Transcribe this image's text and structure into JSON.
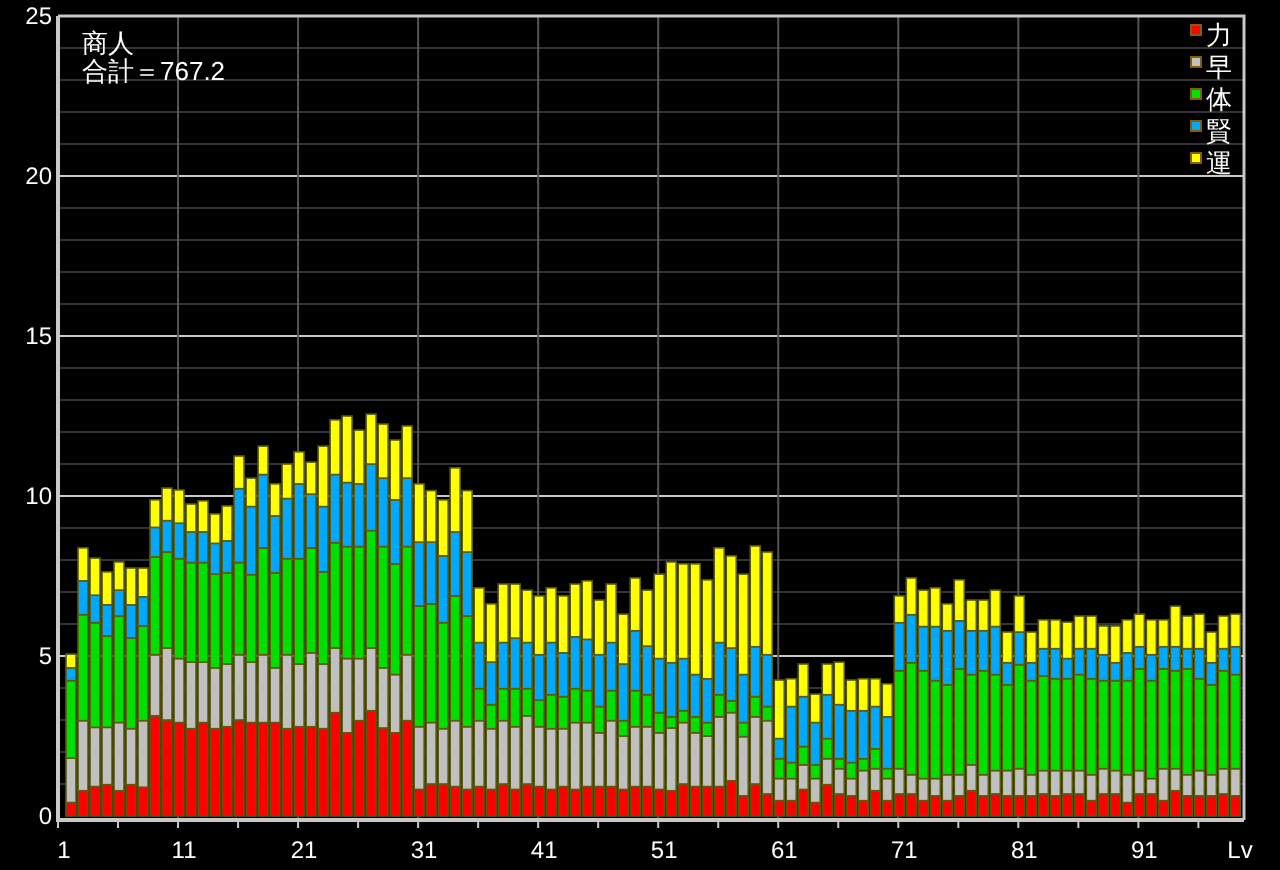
{
  "chart_data": {
    "type": "bar",
    "stacked": true,
    "grid": true,
    "legend": "upper right",
    "orientation": "vertical",
    "title": "商人",
    "annotations": [
      "合計＝767.2"
    ],
    "xlabel": "Lv",
    "xlim": [
      1,
      99.8
    ],
    "ylim": [
      0,
      25
    ],
    "xticks": [
      1,
      11,
      21,
      31,
      41,
      51,
      61,
      71,
      81,
      91
    ],
    "yticks": [
      0,
      5,
      10,
      15,
      20,
      25
    ],
    "x": [
      2,
      3,
      4,
      5,
      6,
      7,
      8,
      9,
      10,
      11,
      12,
      13,
      14,
      15,
      16,
      17,
      18,
      19,
      20,
      21,
      22,
      23,
      24,
      25,
      26,
      27,
      28,
      29,
      30,
      31,
      32,
      33,
      34,
      35,
      36,
      37,
      38,
      39,
      40,
      41,
      42,
      43,
      44,
      45,
      46,
      47,
      48,
      49,
      50,
      51,
      52,
      53,
      54,
      55,
      56,
      57,
      58,
      59,
      60,
      61,
      62,
      63,
      64,
      65,
      66,
      67,
      68,
      69,
      70,
      71,
      72,
      73,
      74,
      75,
      76,
      77,
      78,
      79,
      80,
      81,
      82,
      83,
      84,
      85,
      86,
      87,
      88,
      89,
      90,
      91,
      92,
      93,
      94,
      95,
      96,
      97,
      98,
      99
    ],
    "series": [
      {
        "name": "力",
        "color": "#ff0000",
        "values": [
          0.42,
          0.79,
          0.92,
          0.98,
          0.79,
          0.98,
          0.9,
          3.13,
          3.0,
          2.92,
          2.73,
          2.92,
          2.73,
          2.79,
          3.0,
          2.92,
          2.92,
          2.92,
          2.73,
          2.79,
          2.79,
          2.73,
          3.23,
          2.6,
          2.98,
          3.29,
          2.75,
          2.6,
          2.98,
          0.83,
          1.0,
          1.0,
          0.92,
          0.83,
          0.92,
          0.83,
          1.0,
          0.83,
          1.0,
          0.92,
          0.83,
          0.92,
          0.83,
          0.92,
          0.92,
          0.92,
          0.83,
          0.92,
          0.92,
          0.83,
          0.79,
          1.0,
          0.92,
          0.92,
          0.92,
          1.1,
          0.63,
          1.0,
          0.69,
          0.48,
          0.48,
          0.83,
          0.42,
          0.98,
          0.69,
          0.63,
          0.48,
          0.79,
          0.48,
          0.69,
          0.69,
          0.48,
          0.63,
          0.48,
          0.63,
          0.79,
          0.63,
          0.69,
          0.63,
          0.63,
          0.63,
          0.69,
          0.63,
          0.69,
          0.69,
          0.48,
          0.69,
          0.69,
          0.42,
          0.69,
          0.69,
          0.48,
          0.79,
          0.63,
          0.63,
          0.63,
          0.69,
          0.63
        ]
      },
      {
        "name": "早",
        "color": "#c0c0c0",
        "values": [
          1.39,
          2.19,
          1.85,
          1.79,
          2.13,
          1.75,
          2.08,
          1.91,
          2.25,
          2.0,
          2.08,
          1.89,
          1.9,
          1.96,
          2.04,
          1.89,
          2.12,
          1.71,
          2.31,
          1.96,
          2.31,
          2.02,
          2.02,
          2.32,
          1.94,
          1.96,
          1.88,
          1.82,
          2.06,
          1.96,
          1.92,
          1.73,
          2.06,
          1.96,
          2.06,
          1.9,
          1.98,
          1.96,
          2.13,
          1.87,
          1.9,
          1.81,
          2.09,
          2.0,
          1.68,
          2.06,
          1.67,
          1.87,
          1.87,
          1.77,
          1.96,
          1.92,
          1.68,
          1.58,
          2.18,
          2.13,
          1.85,
          2.1,
          2.29,
          0.69,
          0.69,
          0.77,
          0.75,
          0.81,
          0.79,
          0.54,
          0.94,
          0.69,
          0.69,
          0.79,
          0.6,
          0.69,
          0.54,
          0.81,
          0.66,
          0.81,
          0.66,
          0.73,
          0.79,
          0.85,
          0.66,
          0.73,
          0.79,
          0.73,
          0.73,
          0.81,
          0.79,
          0.73,
          0.87,
          0.73,
          0.48,
          1.0,
          0.69,
          0.66,
          0.79,
          0.66,
          0.79,
          0.85
        ]
      },
      {
        "name": "体",
        "color": "#00e000",
        "values": [
          2.42,
          3.31,
          3.27,
          2.86,
          3.33,
          2.83,
          2.96,
          3.06,
          3.0,
          3.12,
          3.11,
          3.11,
          2.93,
          2.85,
          2.88,
          2.73,
          3.34,
          2.97,
          3.0,
          3.29,
          3.28,
          2.88,
          3.29,
          3.5,
          3.5,
          3.67,
          3.79,
          3.46,
          3.38,
          3.77,
          3.71,
          3.31,
          3.9,
          3.46,
          1.0,
          0.75,
          1.0,
          1.19,
          0.85,
          0.84,
          1.06,
          1.0,
          1.06,
          1.0,
          0.82,
          0.94,
          0.48,
          1.13,
          1.0,
          0.63,
          0.35,
          0.37,
          0.5,
          0.42,
          0.69,
          0.37,
          0.44,
          0.63,
          0.44,
          0.62,
          0.5,
          0.57,
          0.43,
          0.63,
          0.31,
          0.5,
          0.37,
          0.62,
          0.31,
          3.06,
          3.5,
          3.37,
          3.06,
          2.81,
          3.31,
          2.82,
          3.25,
          3.0,
          2.68,
          3.25,
          2.94,
          2.96,
          2.87,
          2.87,
          3.0,
          3.0,
          2.75,
          2.81,
          2.94,
          3.18,
          3.06,
          3.12,
          3.06,
          3.31,
          2.87,
          2.81,
          3.06,
          2.94
        ]
      },
      {
        "name": "賢",
        "color": "#00a8ff",
        "values": [
          0.4,
          1.06,
          0.86,
          0.97,
          0.81,
          1.04,
          0.91,
          0.92,
          0.98,
          1.11,
          0.96,
          0.96,
          0.96,
          1.0,
          2.31,
          2.13,
          2.29,
          1.78,
          1.88,
          2.34,
          1.68,
          2.04,
          2.13,
          2.0,
          1.96,
          2.08,
          2.14,
          2.0,
          2.14,
          2.0,
          1.93,
          2.09,
          2.0,
          2.0,
          1.44,
          1.33,
          1.44,
          1.58,
          1.44,
          1.41,
          1.63,
          1.37,
          1.62,
          1.6,
          1.62,
          1.5,
          1.77,
          1.87,
          1.52,
          1.69,
          1.69,
          1.63,
          1.32,
          1.37,
          1.63,
          1.65,
          1.5,
          1.56,
          1.62,
          0.63,
          1.75,
          1.56,
          1.32,
          1.37,
          1.69,
          1.62,
          1.5,
          1.32,
          1.62,
          1.5,
          1.5,
          1.38,
          1.69,
          1.69,
          1.5,
          1.37,
          1.25,
          1.5,
          0.69,
          1.02,
          0.56,
          0.85,
          0.94,
          0.63,
          0.81,
          0.94,
          0.81,
          0.56,
          0.87,
          0.69,
          0.81,
          0.69,
          0.75,
          0.63,
          0.94,
          0.69,
          0.69,
          0.87
        ]
      },
      {
        "name": "運",
        "color": "#ffff00",
        "values": [
          0.43,
          1.03,
          1.16,
          1.03,
          0.88,
          1.15,
          0.9,
          0.86,
          1.02,
          1.04,
          0.87,
          0.97,
          0.92,
          1.09,
          1.02,
          0.89,
          0.89,
          1.0,
          1.08,
          1.0,
          1.0,
          1.89,
          1.71,
          2.08,
          1.68,
          1.56,
          1.69,
          1.87,
          1.63,
          1.82,
          1.61,
          1.75,
          2.0,
          1.92,
          1.71,
          1.82,
          1.83,
          1.69,
          1.64,
          1.84,
          1.71,
          1.78,
          1.65,
          1.83,
          1.71,
          1.83,
          1.56,
          1.65,
          1.75,
          2.64,
          3.15,
          2.96,
          3.46,
          3.09,
          2.96,
          2.88,
          3.14,
          3.15,
          3.21,
          1.83,
          0.87,
          1.02,
          0.89,
          0.96,
          1.33,
          0.96,
          1.0,
          0.87,
          1.03,
          0.84,
          1.15,
          1.14,
          1.21,
          0.84,
          1.28,
          0.96,
          0.96,
          1.14,
          0.96,
          1.13,
          0.96,
          0.9,
          0.9,
          1.14,
          1.02,
          1.02,
          0.9,
          1.15,
          1.03,
          1.02,
          1.09,
          0.84,
          1.27,
          1.02,
          1.08,
          0.96,
          1.02,
          1.02
        ]
      }
    ]
  }
}
